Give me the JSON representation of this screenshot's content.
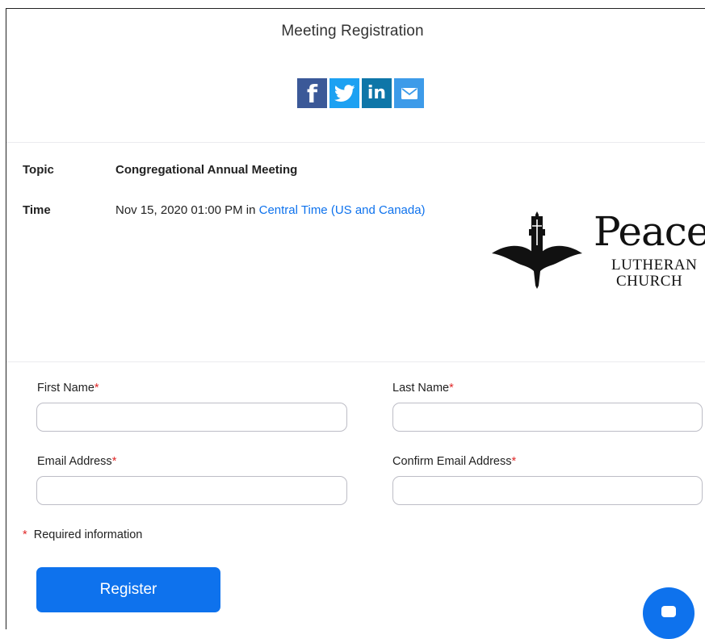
{
  "header": {
    "title": "Meeting Registration"
  },
  "share": {
    "facebook_glyph": "f",
    "linkedin_glyph": "in",
    "icons": [
      "facebook-icon",
      "twitter-icon",
      "linkedin-icon",
      "email-icon"
    ]
  },
  "meeting": {
    "topic_label": "Topic",
    "topic_value": "Congregational Annual Meeting",
    "time_label": "Time",
    "time_value": "Nov 15, 2020 01:00 PM in ",
    "timezone_link": "Central Time (US and Canada)"
  },
  "logo": {
    "name": "Peace",
    "line2": "LUTHERAN",
    "line3": "CHURCH"
  },
  "form": {
    "first_name_label": "First Name",
    "last_name_label": "Last Name",
    "email_label": "Email Address",
    "confirm_email_label": "Confirm Email Address",
    "required_marker": "*",
    "first_name_value": "",
    "last_name_value": "",
    "email_value": "",
    "confirm_email_value": "",
    "required_note": "Required information",
    "register_label": "Register"
  },
  "colors": {
    "accent": "#0e72ed",
    "required": "#e02828",
    "facebook": "#3b5998",
    "twitter": "#1da1f2",
    "linkedin": "#0e76a8",
    "email": "#3d9be9"
  }
}
